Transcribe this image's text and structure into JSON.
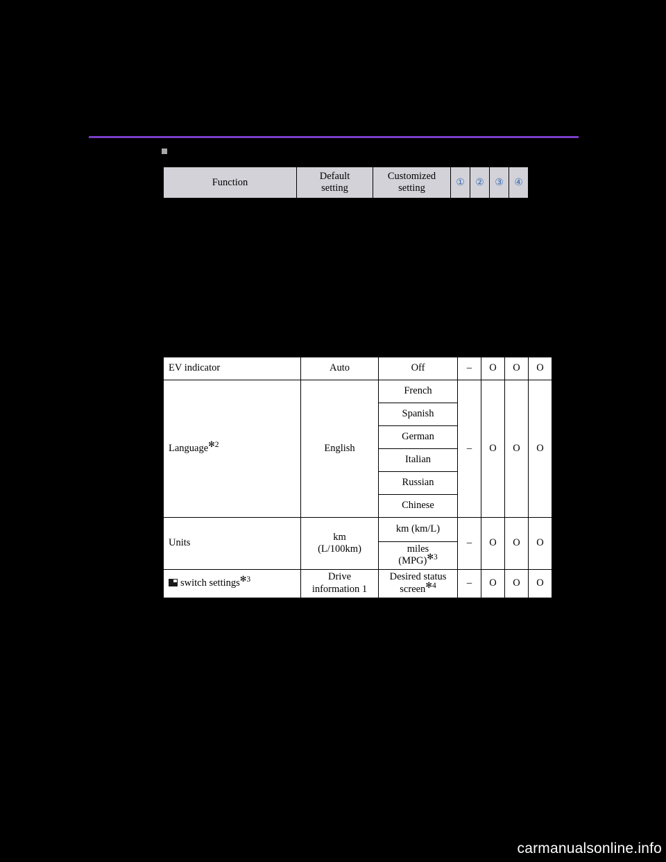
{
  "page": {
    "background_color": "#000000",
    "rule_color": "#7a3ec8",
    "watermark": "carmanualsonline.info"
  },
  "header_table": {
    "columns": [
      "Function",
      "Default setting",
      "Customized setting"
    ],
    "function_label": "Function",
    "default_label": "Default\nsetting",
    "default_line1": "Default",
    "default_line2": "setting",
    "customized_line1": "Customized",
    "customized_line2": "setting",
    "numbers": [
      "①",
      "②",
      "③",
      "④"
    ],
    "number_color": "#3c6fb4",
    "background_color": "#d2d2d8"
  },
  "main_table": {
    "rows": [
      {
        "function": "EV indicator",
        "function_sup": "",
        "default": "Auto",
        "customized": [
          "Off"
        ],
        "marks": [
          "–",
          "O",
          "O",
          "O"
        ]
      },
      {
        "function": "Language",
        "function_sup": "✻2",
        "default": "English",
        "customized": [
          "French",
          "Spanish",
          "German",
          "Italian",
          "Russian",
          "Chinese"
        ],
        "marks": [
          "–",
          "O",
          "O",
          "O"
        ]
      },
      {
        "function": "Units",
        "function_sup": "",
        "default_line1": "km",
        "default_line2": "(L/100km)",
        "customized": [
          "km (km/L)",
          "miles (MPG)"
        ],
        "customized_sup2": "✻3",
        "marks": [
          "–",
          "O",
          "O",
          "O"
        ]
      },
      {
        "function": "switch settings",
        "function_sup": "✻3",
        "function_icon": "switch-icon",
        "default_line1": "Drive",
        "default_line2": "information 1",
        "customized_line1": "Desired status",
        "customized_line2": "screen",
        "customized_sup": "✻4",
        "marks": [
          "–",
          "O",
          "O",
          "O"
        ]
      }
    ],
    "cells": {
      "ev_function": "EV indicator",
      "ev_default": "Auto",
      "ev_custom": "Off",
      "lang_function": "Language",
      "lang_sup": "✻2",
      "lang_default": "English",
      "lang_french": "French",
      "lang_spanish": "Spanish",
      "lang_german": "German",
      "lang_italian": "Italian",
      "lang_russian": "Russian",
      "lang_chinese": "Chinese",
      "units_function": "Units",
      "units_default_1": "km",
      "units_default_2": "(L/100km)",
      "units_custom_1": "km (km/L)",
      "units_custom_2a": "miles",
      "units_custom_2b": "(MPG)",
      "units_custom_2sup": "✻3",
      "sw_function": "switch settings",
      "sw_sup": "✻3",
      "sw_default_1": "Drive",
      "sw_default_2": "information 1",
      "sw_custom_1": "Desired status",
      "sw_custom_2": "screen",
      "sw_custom_sup": "✻4",
      "dash": "–",
      "o": "O"
    }
  }
}
